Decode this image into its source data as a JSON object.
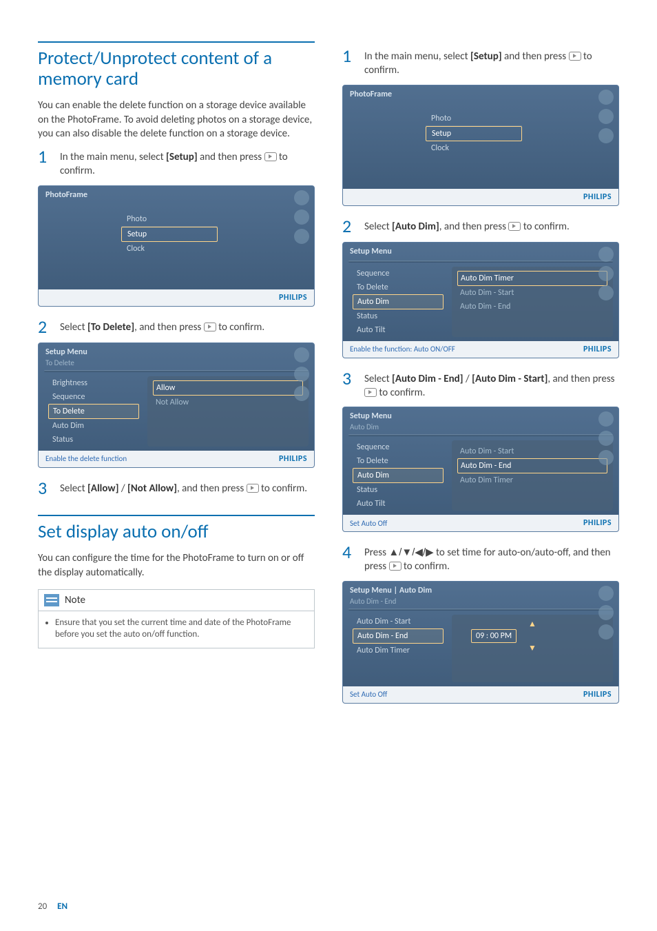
{
  "page": {
    "number": "20",
    "lang": "EN"
  },
  "leftCol": {
    "section1": {
      "title": "Protect/Unprotect content of a memory card",
      "intro": "You can enable the delete function on a storage device available on the PhotoFrame. To avoid deleting photos on a storage device, you can also disable the delete function on a storage device.",
      "step1_a": "In the main menu, select ",
      "step1_bold": "[Setup]",
      "step1_b": " and then press ",
      "step1_c": " to confirm.",
      "dev1": {
        "title": "PhotoFrame",
        "items": [
          "Photo",
          "Setup",
          "Clock"
        ],
        "selected": "Setup",
        "logo": "PHILIPS"
      },
      "step2_a": "Select ",
      "step2_bold": "[To Delete]",
      "step2_b": ", and then press ",
      "step2_c": " to confirm.",
      "dev2": {
        "title": "Setup Menu",
        "sub": "To Delete",
        "left": [
          "Brightness",
          "Sequence",
          "To Delete",
          "Auto Dim",
          "Status"
        ],
        "leftSel": "To Delete",
        "right": [
          "Allow",
          "Not Allow"
        ],
        "rightSel": "Allow",
        "hint": "Enable the delete function",
        "logo": "PHILIPS"
      },
      "step3_a": "Select ",
      "step3_bold1": "[Allow]",
      "step3_slash": " / ",
      "step3_bold2": "[Not Allow]",
      "step3_b": ", and then press ",
      "step3_c": " to confirm."
    },
    "section2": {
      "title": "Set display auto on/off",
      "intro": "You can configure the time for the PhotoFrame to turn on or off the display automatically.",
      "note_title": "Note",
      "note_body": "Ensure that you set the current time and date of the PhotoFrame before you set the auto on/off function."
    }
  },
  "rightCol": {
    "step1_a": "In the main menu, select ",
    "step1_bold": "[Setup]",
    "step1_b": " and then press ",
    "step1_c": " to confirm.",
    "dev1": {
      "title": "PhotoFrame",
      "items": [
        "Photo",
        "Setup",
        "Clock"
      ],
      "selected": "Setup",
      "logo": "PHILIPS"
    },
    "step2_a": "Select ",
    "step2_bold": "[Auto Dim]",
    "step2_b": ", and then press ",
    "step2_c": " to confirm.",
    "dev2": {
      "title": "Setup Menu",
      "left": [
        "Sequence",
        "To Delete",
        "Auto Dim",
        "Status",
        "Auto Tilt"
      ],
      "leftSel": "Auto Dim",
      "right": [
        "Auto Dim Timer",
        "Auto Dim - Start",
        "Auto Dim - End"
      ],
      "rightSel": "Auto Dim Timer",
      "hint": "Enable the function: Auto ON/OFF",
      "logo": "PHILIPS"
    },
    "step3_a": "Select ",
    "step3_bold1": "[Auto Dim - End]",
    "step3_slash": " / ",
    "step3_bold2": "[Auto Dim - Start]",
    "step3_b": ", and then press ",
    "step3_c": " to confirm.",
    "dev3": {
      "title": "Setup Menu",
      "sub": "Auto Dim",
      "left": [
        "Sequence",
        "To Delete",
        "Auto Dim",
        "Status",
        "Auto Tilt"
      ],
      "leftSel": "Auto Dim",
      "right": [
        "Auto Dim - Start",
        "Auto Dim - End",
        "Auto Dim Timer"
      ],
      "rightSel": "Auto Dim - End",
      "hint": "Set Auto Off",
      "logo": "PHILIPS"
    },
    "step4_a": "Press ",
    "step4_arrows": "▲/▼/◀/▶",
    "step4_b": " to set time for auto-on/auto-off, and then press ",
    "step4_c": " to confirm.",
    "dev4": {
      "title": "Setup Menu | Auto Dim",
      "sub": "Auto Dim - End",
      "left": [
        "Auto Dim - Start",
        "Auto Dim - End",
        "Auto Dim Timer"
      ],
      "leftSel": "Auto Dim - End",
      "time": "09 : 00  PM",
      "hint": "Set Auto Off",
      "logo": "PHILIPS"
    }
  }
}
